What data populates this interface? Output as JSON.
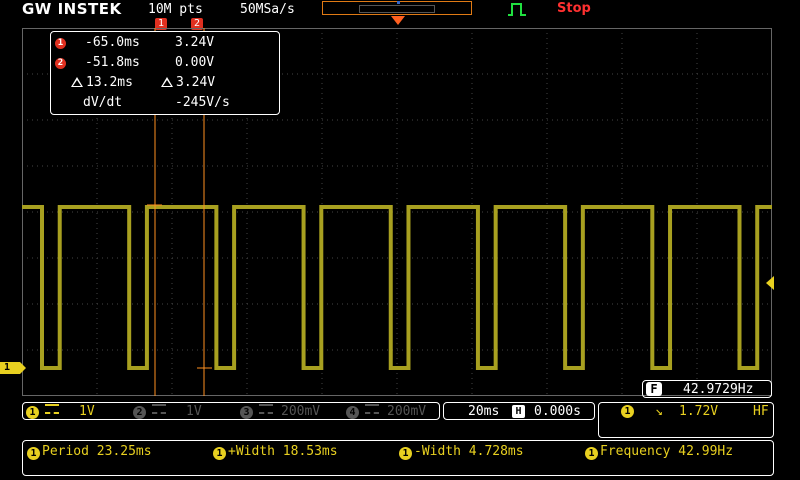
{
  "header": {
    "brand": "GW INSTEK",
    "memory_depth": "10M pts",
    "sample_rate": "50MSa/s",
    "run_state": "Stop",
    "cursor_flag_1": "1",
    "cursor_flag_2": "2"
  },
  "cursor_readout": {
    "c1_badge": "1",
    "c1_time": "-65.0ms",
    "c1_volt": "3.24V",
    "c2_badge": "2",
    "c2_time": "-51.8ms",
    "c2_volt": "0.00V",
    "delta_time": "13.2ms",
    "delta_volt": "3.24V",
    "dvdt_label": "dV/dt",
    "dvdt_value": "-245V/s"
  },
  "frequency_counter": {
    "label": "F",
    "value": "42.9729Hz"
  },
  "channels": [
    {
      "badge": "1",
      "scale": "1V",
      "state": "on"
    },
    {
      "badge": "2",
      "scale": "1V",
      "state": "off"
    },
    {
      "badge": "3",
      "scale": "200mV",
      "state": "off"
    },
    {
      "badge": "4",
      "scale": "200mV",
      "state": "off"
    }
  ],
  "timebase": {
    "scale": "20ms",
    "h_label": "H",
    "position": "0.000s"
  },
  "trigger": {
    "source": "1",
    "slope": "↘",
    "level": "1.72V",
    "coupling": "HF"
  },
  "measurements": [
    {
      "badge": "1",
      "text": "Period 23.25ms"
    },
    {
      "badge": "1",
      "text": "+Width 18.53ms"
    },
    {
      "badge": "1",
      "text": "-Width 4.728ms"
    },
    {
      "badge": "1",
      "text": "Frequency 42.99Hz"
    }
  ],
  "ch1_marker": "1",
  "waveform": {
    "color": "#a8a020",
    "period_ms": 23.25,
    "high_width_ms": 18.53,
    "low_width_ms": 4.728,
    "high_level_v": 3.24,
    "low_level_v": 0.0,
    "volts_per_div": 1,
    "ms_per_div": 20
  },
  "colors": {
    "channel1": "#e8d020",
    "cursor": "#ff9020",
    "stop": "#ff3030"
  }
}
